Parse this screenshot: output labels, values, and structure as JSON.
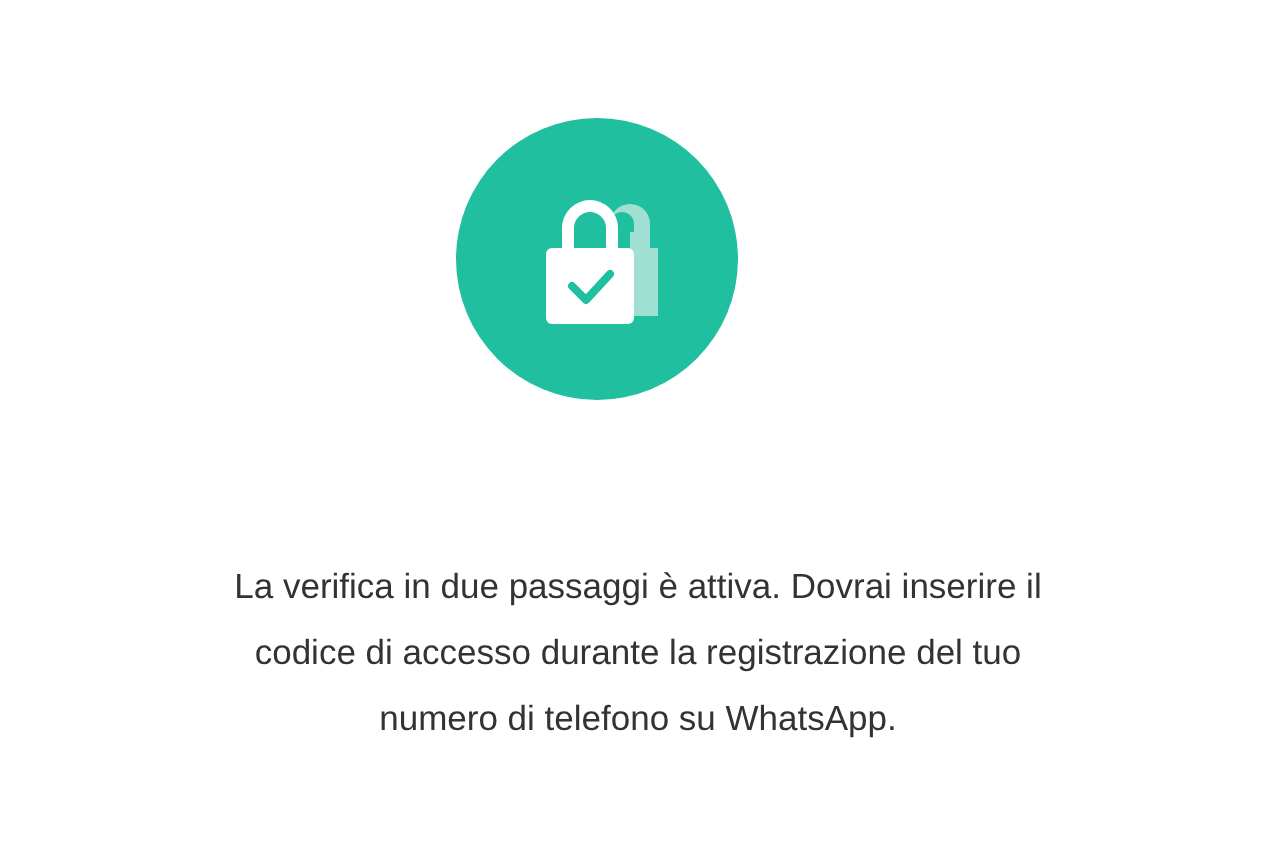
{
  "message": "La verifica in due passaggi è attiva. Dovrai inserire il codice di accesso durante la registrazione del tuo numero di telefono su WhatsApp."
}
